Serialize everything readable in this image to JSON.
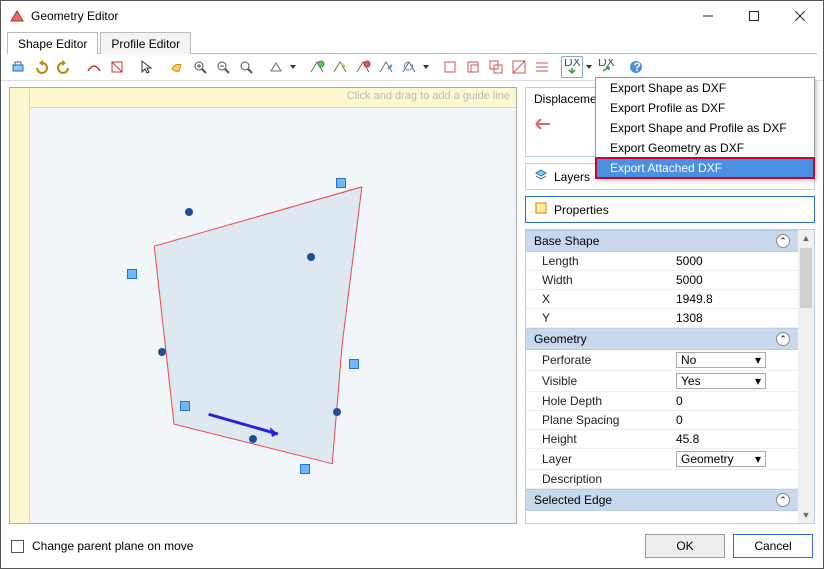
{
  "window": {
    "title": "Geometry Editor"
  },
  "tabs": {
    "shape": "Shape Editor",
    "profile": "Profile Editor"
  },
  "canvas": {
    "guide_hint": "Click and drag to add a guide line"
  },
  "panel": {
    "displacement_label": "Displacement",
    "layers_label": "Layers",
    "properties_label": "Properties"
  },
  "dxf_menu": {
    "items": [
      "Export Shape as DXF",
      "Export Profile as DXF",
      "Export Shape and Profile as DXF",
      "Export Geometry as DXF",
      "Export Attached DXF"
    ],
    "highlighted_index": 4
  },
  "props": {
    "base_shape": {
      "title": "Base Shape",
      "rows": [
        {
          "k": "Length",
          "v": "5000"
        },
        {
          "k": "Width",
          "v": "5000"
        },
        {
          "k": "X",
          "v": "1949.8"
        },
        {
          "k": "Y",
          "v": "1308"
        }
      ]
    },
    "geometry": {
      "title": "Geometry",
      "rows": [
        {
          "k": "Perforate",
          "v": "No",
          "select": true
        },
        {
          "k": "Visible",
          "v": "Yes",
          "select": true
        },
        {
          "k": "Hole Depth",
          "v": "0"
        },
        {
          "k": "Plane Spacing",
          "v": "0"
        },
        {
          "k": "Height",
          "v": "45.8"
        },
        {
          "k": "Layer",
          "v": "Geometry",
          "select": true
        },
        {
          "k": "Description",
          "v": ""
        }
      ]
    },
    "selected_edge": {
      "title": "Selected Edge"
    }
  },
  "footer": {
    "checkbox_label": "Change parent plane on move",
    "ok": "OK",
    "cancel": "Cancel"
  }
}
